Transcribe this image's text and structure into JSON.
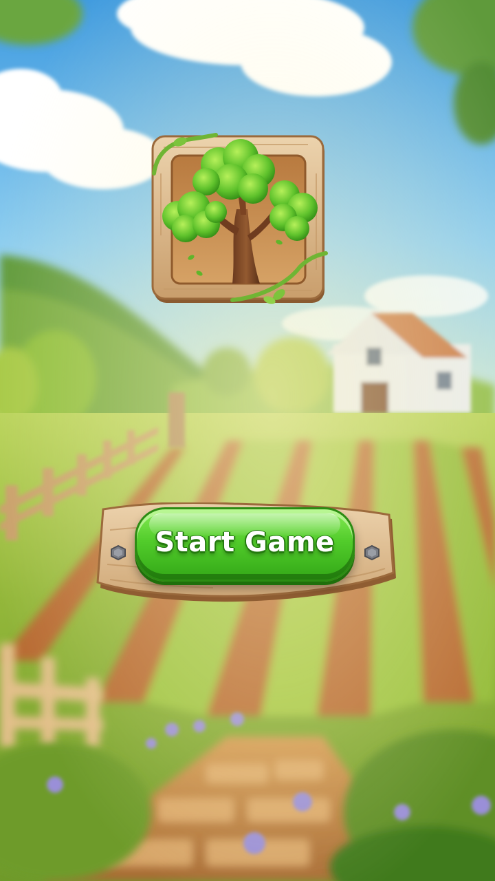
{
  "start_button": {
    "label": "Start Game"
  },
  "colors": {
    "button_green": "#52cc2b",
    "wood": "#d8b38a",
    "sky": "#5aaee6",
    "field_green": "#8fbf3a"
  },
  "icons": {
    "logo": "tree-icon",
    "left_bolt": "bolt-icon",
    "right_bolt": "bolt-icon"
  }
}
